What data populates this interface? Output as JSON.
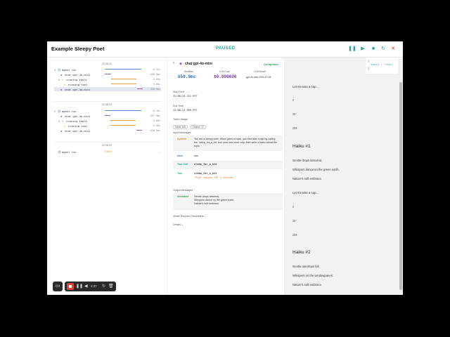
{
  "app": {
    "title": "Example Sleepy Poet",
    "status": "PAUSED",
    "controls": [
      "❚❚",
      "▶",
      "■",
      "↻",
      "✕"
    ]
  },
  "trace_groups": [
    {
      "time": "22:08:31",
      "rows": [
        {
          "label": "agent run",
          "duration": "8.21s"
        },
        {
          "label": "chat gpt-4o-mini",
          "duration": "658.9ms"
        },
        {
          "label": "running tools",
          "duration": "3.00s"
        },
        {
          "label": "running tool",
          "duration": "3.00s"
        },
        {
          "label": "chat gpt-4o-mini",
          "duration": "658.9ms"
        }
      ]
    },
    {
      "time": "22:08:23",
      "rows": [
        {
          "label": "agent run",
          "duration": "8.18s"
        },
        {
          "label": "chat gpt-4o-mini",
          "duration": "597.9ms"
        },
        {
          "label": "running tools",
          "duration": "3.00s"
        },
        {
          "label": "running tool",
          "duration": "3.00s"
        },
        {
          "label": "chat gpt-4o-mini",
          "duration": "658.9ms"
        }
      ]
    },
    {
      "time": "22:08:20",
      "rows": [
        {
          "label": "agent run",
          "status": "Failed"
        }
      ]
    }
  ],
  "detail": {
    "title": "chat gpt-4o-mini",
    "status": "Completed",
    "stats": [
      {
        "label": "Duration",
        "value": "658.9ms"
      },
      {
        "label": "LLM Cost",
        "value": "$0.000030"
      },
      {
        "label": "LLM Model",
        "value": "gpt-4o-mini-2024-07-18"
      }
    ],
    "start_label": "Start Time",
    "start_value": "22:08:23.251 PST",
    "end_label": "End Time",
    "end_value": "22:08:23.909 PST",
    "token_label": "Token Usage",
    "input_tokens": "Input: 116",
    "output_tokens": "Output: 27",
    "input_messages_label": "Input Messages",
    "messages": [
      {
        "role": "System",
        "text": "You are a sleepy poet. When given a topic, you first take a nap by calling the `sleep_for_a_bit` tool once and once only, then write a haiku about the topic."
      },
      {
        "role": "User",
        "text": "rain"
      },
      {
        "role": "Tool Call",
        "text": "sleep_for_a_bit"
      },
      {
        "role": "Tool",
        "text": "sleep_for_a_bit",
        "result": "\"Poet napped for 3 seconds.\""
      }
    ],
    "output_messages_label": "Output Messages",
    "output": {
      "role": "Assistant",
      "text": "Gentle drops descend,\nWhispers dance on the green earth,\nNature's soft embrace."
    },
    "model_params": "Model Request Parameters ⌄",
    "details": "Details ⌄"
  },
  "output_panel": {
    "lines": [
      {
        "kind": "p",
        "text": "Let me take a nap..."
      },
      {
        "kind": "p",
        "text": "z"
      },
      {
        "kind": "p",
        "text": "zz"
      },
      {
        "kind": "p",
        "text": "zzz"
      },
      {
        "kind": "h",
        "text": "Haiku #1"
      },
      {
        "kind": "p",
        "text": "Gentle drops descend,"
      },
      {
        "kind": "p",
        "text": "Whispers dance on the green earth,"
      },
      {
        "kind": "p",
        "text": "Nature's soft embrace."
      },
      {
        "kind": "p",
        "text": "Let me take a nap..."
      },
      {
        "kind": "p",
        "text": "z"
      },
      {
        "kind": "p",
        "text": "zz"
      },
      {
        "kind": "p",
        "text": "zzz"
      },
      {
        "kind": "h",
        "text": "Haiku #2"
      },
      {
        "kind": "p",
        "text": "Gentle raindrops fall,"
      },
      {
        "kind": "p",
        "text": "Whispers on the windowpanes,"
      },
      {
        "kind": "p",
        "text": "Nature's soft embrace."
      }
    ]
  },
  "json_panel": {
    "open": "{",
    "key": "\"topic\"",
    "value": "\"rain\"",
    "close": "}"
  },
  "recorder": {
    "time": "4:37"
  },
  "colors": {
    "accent": "#2aa39b",
    "blue_bar": "#5b8fd6",
    "orange_bar": "#e8a23a",
    "purple_bar": "#9b5fc0",
    "failed": "#e8a23a"
  }
}
